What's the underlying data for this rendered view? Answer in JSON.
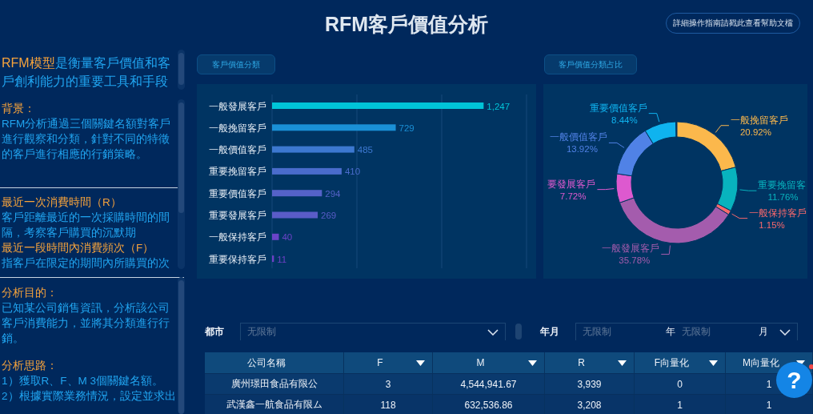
{
  "header": {
    "title": "RFM客戶價值分析",
    "help_link": "詳細操作指南請戳此查看幫助文檔"
  },
  "left_panel": {
    "intro": {
      "highlight": "RFM模型",
      "text": "是衡量客戶價值和客戶創利能力的重要工具和手段"
    },
    "sections": [
      {
        "blocks": [
          {
            "kind": "heading",
            "text": "背景："
          },
          {
            "kind": "text",
            "text": "RFM分析通過三個關鍵名額對客戶進行觀察和分類，針對不同的特徵的客戶進行相應的行銷策略。"
          },
          {
            "kind": "divider"
          },
          {
            "kind": "heading",
            "text": "最近一次消費時間（R）"
          },
          {
            "kind": "text",
            "text": "客戶距離最近的一次採購時間的間隔，考察客戶購買的沉默期"
          },
          {
            "kind": "heading",
            "text": "最近一段時間內消費頻次（F）"
          },
          {
            "kind": "text",
            "text": "指客戶在限定的期間內所購買的次"
          }
        ]
      },
      {
        "blocks": [
          {
            "kind": "divider"
          },
          {
            "kind": "heading",
            "text": "分析目的："
          },
          {
            "kind": "text",
            "text": "已知某公司銷售資訊，分析該公司客戶消費能力，並將其分類進行行銷。"
          },
          {
            "kind": "spacer"
          },
          {
            "kind": "heading",
            "text": "分析思路："
          },
          {
            "kind": "text",
            "text": "1）獲取R、F、M 3個關鍵名額。"
          },
          {
            "kind": "text",
            "text": "2）根據實際業務情況，設定並求出"
          }
        ]
      }
    ]
  },
  "bar_panel": {
    "title": "客戶價值分類",
    "chart_data": {
      "type": "bar",
      "orientation": "horizontal",
      "categories": [
        "一般發展客戶",
        "一般挽留客戶",
        "一般價值客戶",
        "重要挽留客戶",
        "重要價值客戶",
        "重要發展客戶",
        "一般保持客戶",
        "重要保持客戶"
      ],
      "values": [
        1247,
        729,
        485,
        410,
        294,
        269,
        40,
        11
      ],
      "value_labels": [
        "1,247",
        "729",
        "485",
        "410",
        "294",
        "269",
        "40",
        "11"
      ],
      "colors": [
        "#00c4d8",
        "#1a90d6",
        "#3c78d0",
        "#4a6ccc",
        "#5562c8",
        "#5a5cc8",
        "#6a44c8",
        "#6e40c6"
      ]
    }
  },
  "donut_panel": {
    "title": "客戶價值分類占比",
    "chart_data": {
      "type": "donut",
      "categories": [
        "一般挽留客戶",
        "重要挽留客",
        "一般保持客戶",
        "一般發展客戶",
        "要發展客戶",
        "一般價值客戶",
        "重要價值客戶"
      ],
      "values": [
        20.92,
        11.76,
        1.15,
        35.78,
        7.72,
        13.92,
        8.44
      ],
      "value_labels": [
        "20.92%",
        "11.76%",
        "1.15%",
        "35.78%",
        "7.72%",
        "13.92%",
        "8.44%"
      ],
      "colors": [
        "#fbb84c",
        "#08b3be",
        "#f9686c",
        "#a45cad",
        "#dd59cf",
        "#5082e6",
        "#0fb3ef"
      ]
    }
  },
  "filters": {
    "city": {
      "label": "都市",
      "placeholder": "无限制"
    },
    "month": {
      "label": "年月",
      "year_placeholder": "无限制",
      "year_unit": "年",
      "month_placeholder": "无限制",
      "month_unit": "月"
    }
  },
  "table": {
    "columns": [
      {
        "label": "公司名稱",
        "filter": false
      },
      {
        "label": "F",
        "filter": true
      },
      {
        "label": "M",
        "filter": true
      },
      {
        "label": "R",
        "filter": true
      },
      {
        "label": "F向量化",
        "filter": true
      },
      {
        "label": "M向量化",
        "filter": true
      }
    ],
    "rows": [
      [
        "廣州璟田食品有限公",
        "3",
        "4,544,941.67",
        "3,939",
        "0",
        "1"
      ],
      [
        "武漢鑫一航食品有限ム",
        "118",
        "632,536.86",
        "3,208",
        "1",
        "1"
      ]
    ]
  },
  "help_button": {
    "label": "?",
    "notification": true
  }
}
